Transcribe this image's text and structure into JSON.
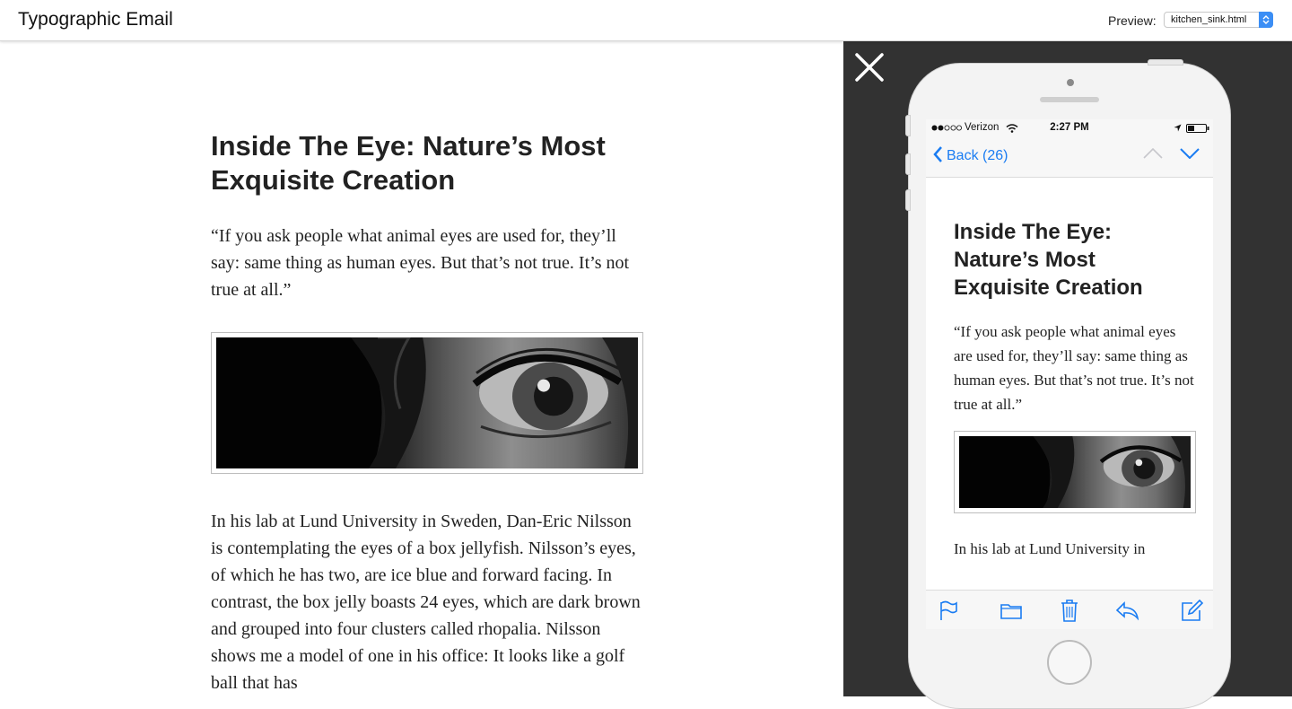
{
  "header": {
    "title": "Typographic Email",
    "preview_label": "Preview:",
    "preview_value": "kitchen_sink.html"
  },
  "article": {
    "title": "Inside The Eye: Nature’s Most Exquisite Creation",
    "quote": "“If you ask people what animal eyes are used for, they’ll say: same thing as human eyes. But that’s not true. It’s not true at all.”",
    "body": "In his lab at Lund University in Sweden, Dan-Eric Nilsson is contemplating the eyes of a box jellyfish. Nilsson’s eyes, of which he has two, are ice blue and forward facing. In contrast, the box jelly boasts 24 eyes, which are dark brown and grouped into four clusters called rhopalia. Nilsson shows me a model of one in his office: It looks like a golf ball that has"
  },
  "phone": {
    "status": {
      "carrier": "Verizon",
      "time": "2:27 PM"
    },
    "nav": {
      "back_label": "Back (26)"
    },
    "mail_visible_text": "In his lab at Lund University in"
  },
  "colors": {
    "accent": "#1a7cf2",
    "panel": "#323232",
    "select_blue": "#3b8ef5"
  },
  "icons": [
    "close-icon",
    "chevron-left-icon",
    "chevron-up-icon",
    "chevron-down-icon",
    "flag-icon",
    "folder-icon",
    "trash-icon",
    "reply-icon",
    "compose-icon",
    "wifi-icon",
    "location-icon",
    "battery-icon"
  ]
}
